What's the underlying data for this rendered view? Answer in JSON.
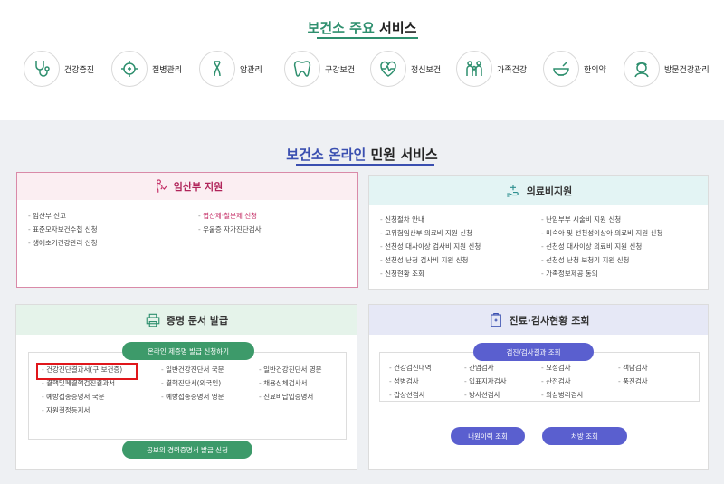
{
  "top": {
    "title_hl": "보건소 주요",
    "title_rest": " 서비스",
    "services": [
      {
        "label": "건강증진",
        "icon": "stethoscope-icon"
      },
      {
        "label": "질병관리",
        "icon": "virus-icon"
      },
      {
        "label": "암관리",
        "icon": "ribbon-icon"
      },
      {
        "label": "구강보건",
        "icon": "tooth-icon"
      },
      {
        "label": "정신보건",
        "icon": "heart-pulse-icon"
      },
      {
        "label": "가족건강",
        "icon": "family-icon"
      },
      {
        "label": "한의약",
        "icon": "mortar-icon"
      },
      {
        "label": "방문건강관리",
        "icon": "nurse-icon"
      }
    ]
  },
  "mid": {
    "title_hl": "보건소 온라인",
    "title_rest": " 민원 서비스"
  },
  "pregnancy": {
    "title": "임산부 지원",
    "col_a": [
      "임산부 신고",
      "표준모자보건수첩 신청",
      "생애초기건강관리 신청"
    ],
    "col_b": [
      "엽산제·철분제 신청",
      "우울증 자가진단검사"
    ]
  },
  "medical": {
    "title": "의료비지원",
    "col_a": [
      "신청절차 안내",
      "고위험임산부 의료비 지원 신청",
      "선천성 대사이상 검사비 지원 신청",
      "선천성 난청 검사비 지원 신청",
      "신청현황 조회"
    ],
    "col_b": [
      "난임부부 시술비 지원 신청",
      "미숙아 및 선천성이상아 의료비 지원 신청",
      "선천성 대사이상 의료비 지원 신청",
      "선천성 난청 보청기 지원 신청",
      "가족정보제공 동의"
    ]
  },
  "documents": {
    "title": "증명 문서 발급",
    "button_top": "온라인 제증명 발급 신청하기",
    "button_bottom": "공보의 경력증명서 발급 신청",
    "col_a": [
      "건강진단결과서(구 보건증)",
      "결핵및폐결핵검진결과서",
      "예방접종증명서 국문",
      "자원결정등지서"
    ],
    "col_b": [
      "일반건강진단서 국문",
      "결핵진단서(외국인)",
      "예방접종증명서 영문"
    ],
    "col_c": [
      "일반건강진단서 영문",
      "채용신체검사서",
      "진료비납입증명서"
    ]
  },
  "exams": {
    "title": "진료·검사현황 조회",
    "button_top": "검진/검사결과 조회",
    "button_a": "내원이력 조회",
    "button_b": "처방 조회",
    "col_a": [
      "건강검진내역",
      "성병검사",
      "갑상선검사"
    ],
    "col_b": [
      "간염검사",
      "입표지자검사",
      "방사선검사"
    ],
    "col_c": [
      "요성검사",
      "산전검사",
      "의심병리검사"
    ],
    "col_d": [
      "객담검사",
      "풍진검사"
    ]
  },
  "colors": {
    "green": "#2e8f6e",
    "blue": "#3a4fb0",
    "pink": "#c32a63",
    "purple": "#5a5fcf",
    "highlight": "#e0161b"
  }
}
